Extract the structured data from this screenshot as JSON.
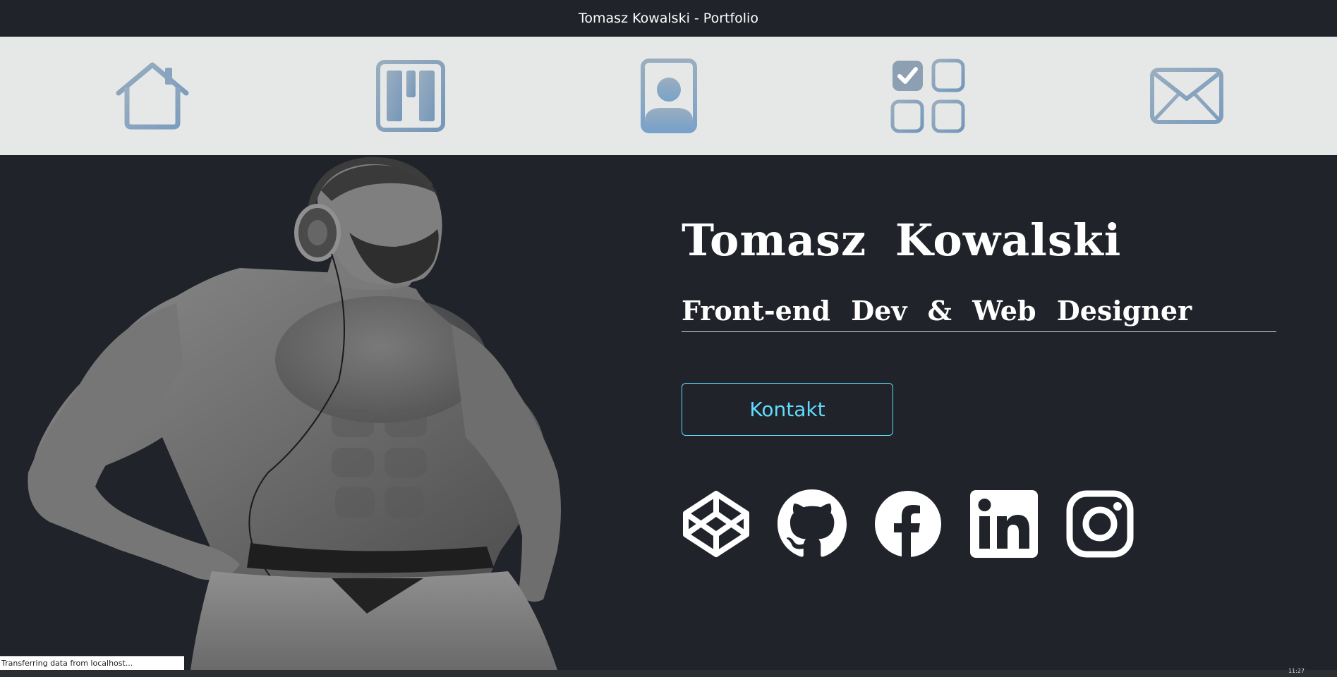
{
  "window": {
    "title": "Tomasz Kowalski - Portfolio"
  },
  "nav": {
    "items": [
      {
        "icon": "home-icon"
      },
      {
        "icon": "kanban-icon"
      },
      {
        "icon": "person-badge-icon"
      },
      {
        "icon": "ui-checks-grid-icon"
      },
      {
        "icon": "envelope-icon"
      }
    ],
    "icon_color": "#8aa4bf",
    "background": "#e6e8e8"
  },
  "hero": {
    "name": "Tomasz Kowalski",
    "subtitle": "Front-end Dev & Web Designer",
    "contact_button": "Kontakt",
    "accent_color": "#61dafb",
    "background": "#20232a"
  },
  "social": [
    {
      "icon": "codepen-icon"
    },
    {
      "icon": "github-icon"
    },
    {
      "icon": "facebook-icon"
    },
    {
      "icon": "linkedin-icon"
    },
    {
      "icon": "instagram-icon"
    }
  ],
  "status": {
    "text": "Transferring data from localhost...",
    "clock": "11:27"
  }
}
